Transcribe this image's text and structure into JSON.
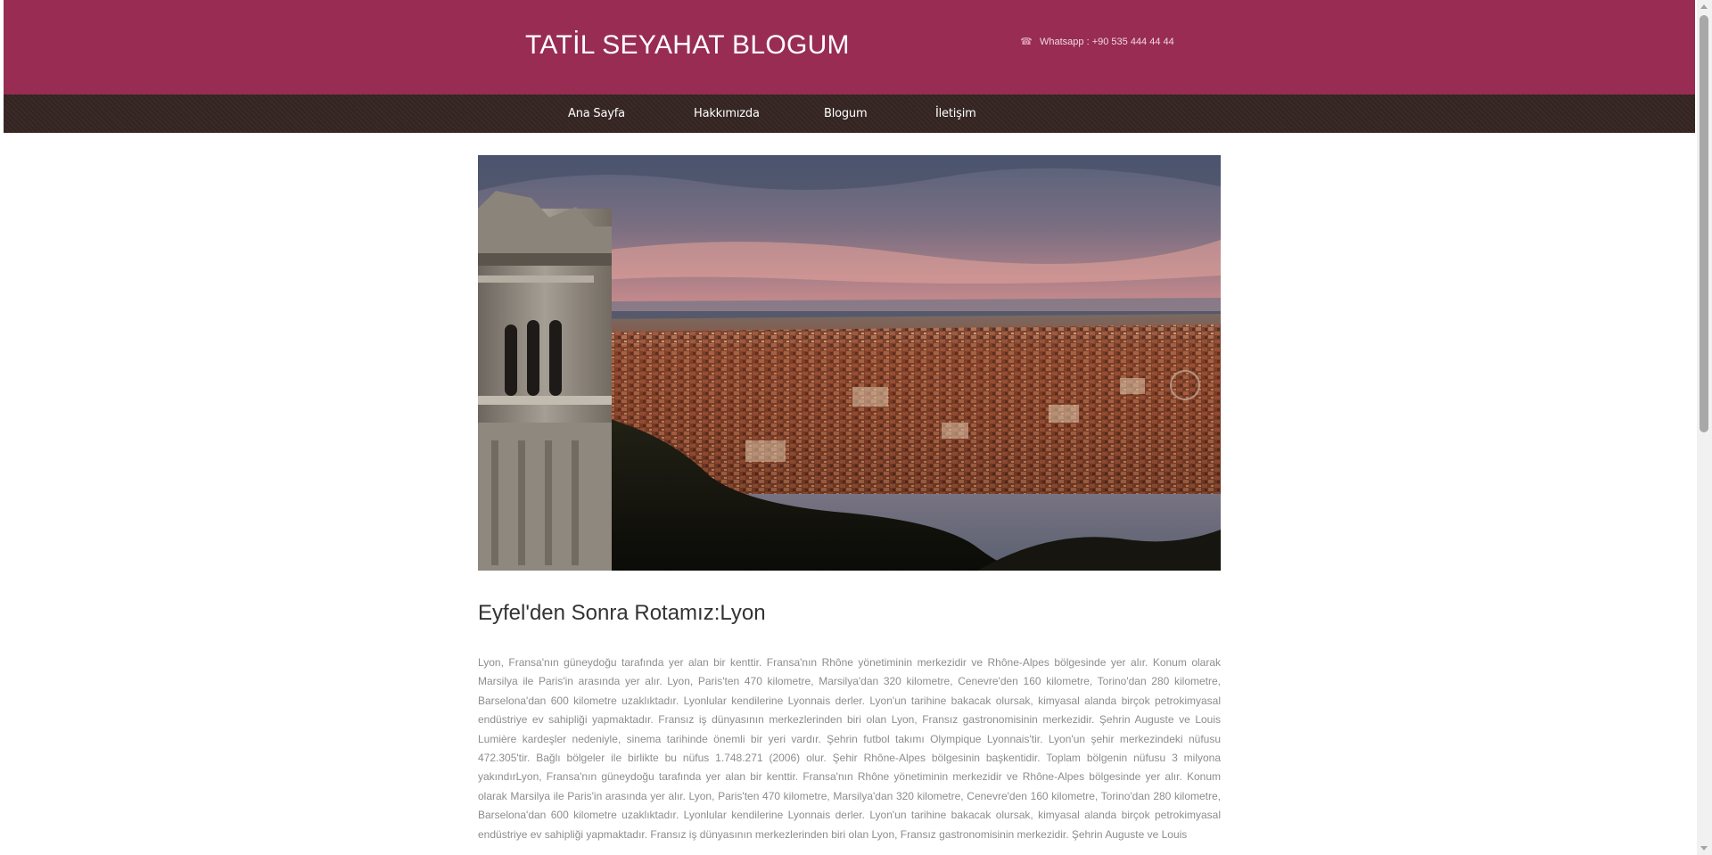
{
  "header": {
    "site_title": "TATİL SEYAHAT BLOGUM",
    "contact_icon": "phone-icon",
    "contact_text": "Whatsapp : +90 535 444 44 44"
  },
  "nav": {
    "items": [
      {
        "label": "Ana Sayfa"
      },
      {
        "label": "Hakkımızda"
      },
      {
        "label": "Blogum"
      },
      {
        "label": "İletişim"
      }
    ]
  },
  "post": {
    "title": "Eyfel'den Sonra Rotamız:Lyon",
    "body": "Lyon, Fransa'nın güneydoğu tarafında yer alan bir kenttir. Fransa'nın Rhône yönetiminin merkezidir ve Rhône-Alpes bölgesinde yer alır. Konum olarak Marsilya ile Paris'in arasında yer alır. Lyon, Paris'ten 470 kilometre, Marsilya'dan 320 kilometre, Cenevre'den 160 kilometre, Torino'dan 280 kilometre, Barselona'dan 600 kilometre uzaklıktadır. Lyonlular kendilerine Lyonnais derler. Lyon'un tarihine bakacak olursak, kimyasal alanda birçok petrokimyasal endüstriye ev sahipliği yapmaktadır. Fransız iş dünyasının merkezlerinden biri olan Lyon, Fransız gastronomisinin merkezidir. Şehrin Auguste ve Louis Lumière kardeşler nedeniyle, sinema tarihinde önemli bir yeri vardır. Şehrin futbol takımı Olympique Lyonnais'tir. Lyon'un şehir merkezindeki nüfusu 472.305'tir. Bağlı bölgeler ile birlikte bu nüfus 1.748.271 (2006) olur. Şehir Rhône-Alpes bölgesinin başkentidir. Toplam bölgenin nüfusu 3 milyona yakındırLyon, Fransa'nın güneydoğu tarafında yer alan bir kenttir. Fransa'nın Rhône yönetiminin merkezidir ve Rhône-Alpes bölgesinde yer alır. Konum olarak Marsilya ile Paris'in arasında yer alır. Lyon, Paris'ten 470 kilometre, Marsilya'dan 320 kilometre, Cenevre'den 160 kilometre, Torino'dan 280 kilometre, Barselona'dan 600 kilometre uzaklıktadır. Lyonlular kendilerine Lyonnais derler. Lyon'un tarihine bakacak olursak, kimyasal alanda birçok petrokimyasal endüstriye ev sahipliği yapmaktadır. Fransız iş dünyasının merkezlerinden biri olan Lyon, Fransız gastronomisinin merkezidir. Şehrin Auguste ve Louis"
  },
  "colors": {
    "header_bg": "#982c53",
    "nav_bg": "#352523",
    "body_text": "#8d8d8d",
    "title_text": "#333333"
  }
}
